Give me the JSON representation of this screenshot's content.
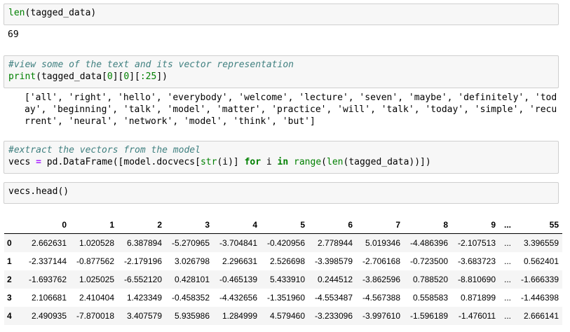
{
  "cell1": {
    "call": "len",
    "arg": "tagged_data"
  },
  "output1": "69",
  "cell2": {
    "comment": "#view some of the text and its vector representation",
    "fn": "print",
    "var": "tagged_data",
    "idx0": "0",
    "idx1": "0",
    "slice": ":25"
  },
  "output2": "['all', 'right', 'hello', 'everybody', 'welcome', 'lecture', 'seven', 'maybe', 'definitely', 'today', 'beginning', 'talk', 'model', 'matter', 'practice', 'will', 'talk', 'today', 'simple', 'recurrent', 'neural', 'network', 'model', 'think', 'but']",
  "cell3": {
    "comment": "#extract the vectors from the model",
    "lhs": "vecs",
    "eq": "=",
    "call": "pd.DataFrame",
    "inner1": "model.docvecs[",
    "str_fn": "str",
    "inner2": "(i)] ",
    "for_kw": "for",
    "iv": " i ",
    "in_kw": "in",
    "range_fn": "range",
    "len_fn": "len",
    "arg": "tagged_data"
  },
  "cell4": {
    "code": "vecs.head()"
  },
  "dataframe": {
    "columns": [
      "0",
      "1",
      "2",
      "3",
      "4",
      "5",
      "6",
      "7",
      "8",
      "9",
      "...",
      "55"
    ],
    "rows": [
      {
        "index": "0",
        "values": [
          "2.662631",
          "1.020528",
          "6.387894",
          "-5.270965",
          "-3.704841",
          "-0.420956",
          "2.778944",
          "5.019346",
          "-4.486396",
          "-2.107513",
          "...",
          "3.396559"
        ]
      },
      {
        "index": "1",
        "values": [
          "-2.337144",
          "-0.877562",
          "-2.179196",
          "3.026798",
          "2.296631",
          "2.526698",
          "-3.398579",
          "-2.706168",
          "-0.723500",
          "-3.683723",
          "...",
          "0.562401"
        ]
      },
      {
        "index": "2",
        "values": [
          "-1.693762",
          "1.025025",
          "-6.552120",
          "0.428101",
          "-0.465139",
          "5.433910",
          "0.244512",
          "-3.862596",
          "0.788520",
          "-8.810690",
          "...",
          "-1.666339"
        ]
      },
      {
        "index": "3",
        "values": [
          "2.106681",
          "2.410404",
          "1.423349",
          "-0.458352",
          "-4.432656",
          "-1.351960",
          "-4.553487",
          "-4.567388",
          "0.558583",
          "0.871899",
          "...",
          "-1.446398"
        ]
      },
      {
        "index": "4",
        "values": [
          "2.490935",
          "-7.870018",
          "3.407579",
          "5.935986",
          "1.284999",
          "4.579460",
          "-3.233096",
          "-3.997610",
          "-1.596189",
          "-1.476011",
          "...",
          "2.666141"
        ]
      }
    ]
  }
}
